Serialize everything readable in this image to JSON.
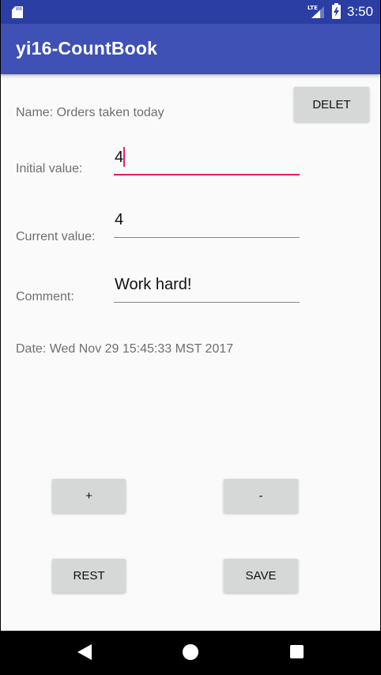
{
  "status_bar": {
    "network": "LTE",
    "time": "3:50"
  },
  "app_bar": {
    "title": "yi16-CountBook"
  },
  "counter": {
    "name_text": "Name: Orders taken today",
    "delete_label": "DELET",
    "initial_label": "Initial value:",
    "initial_value": "4",
    "current_label": "Current value:",
    "current_value": "4",
    "comment_label": "Comment:",
    "comment_value": "Work hard!",
    "date_text": "Date: Wed Nov 29 15:45:33 MST 2017"
  },
  "actions": {
    "increment_label": "+",
    "decrement_label": "-",
    "reset_label": "REST",
    "save_label": "SAVE"
  },
  "colors": {
    "primary": "#3f51b5",
    "primary_dark": "#2b3ea3",
    "accent": "#e91e63",
    "button": "#d6d7d7"
  },
  "icons": [
    "sd-card-icon",
    "signal-icon",
    "battery-charging-icon",
    "back-icon",
    "home-icon",
    "recents-icon"
  ]
}
